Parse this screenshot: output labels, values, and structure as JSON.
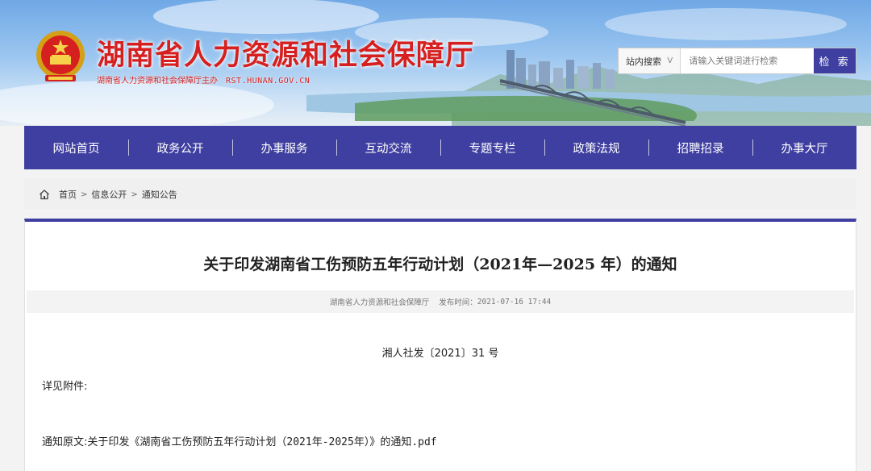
{
  "header": {
    "site_title": "湖南省人力资源和社会保障厅",
    "sponsor": "湖南省人力资源和社会保障厅主办",
    "domain": "RST.HUNAN.GOV.CN"
  },
  "search": {
    "scope_label": "站内搜索",
    "scope_chevron": "V",
    "placeholder": "请输入关键词进行检索",
    "button_label": "检 索"
  },
  "nav": {
    "items": [
      "网站首页",
      "政务公开",
      "办事服务",
      "互动交流",
      "专题专栏",
      "政策法规",
      "招聘招录",
      "办事大厅"
    ]
  },
  "breadcrumb": {
    "icon": "home-icon",
    "items": [
      "首页",
      "信息公开",
      "通知公告"
    ],
    "separator": ">"
  },
  "article": {
    "title": "关于印发湖南省工伤预防五年行动计划（2021年—2025 年）的通知",
    "publisher": "湖南省人力资源和社会保障厅",
    "publish_label": "发布时间：",
    "publish_time": "2021-07-16 17:44",
    "doc_number": "湘人社发〔2021〕31 号",
    "intro": "详见附件:",
    "attachment_prefix": "通知原文:",
    "attachment_name": "关于印发《湖南省工伤预防五年行动计划（2021年-2025年）》的通知.pdf"
  },
  "colors": {
    "accent": "#3f3fa1",
    "title_red": "#d6201f"
  }
}
